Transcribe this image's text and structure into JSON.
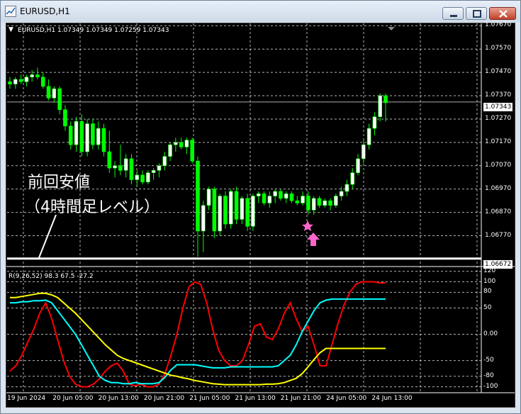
{
  "window": {
    "title": "EURUSD,H1",
    "buttons": {
      "minimize": "minimize",
      "maximize": "maximize",
      "close": "close"
    }
  },
  "chart_header": "EURUSD,H1  1.07349 1.07349 1.07259 1.07343",
  "price_axis": [
    "1.07670",
    "1.07570",
    "1.07470",
    "1.07370",
    "1.07270",
    "1.07170",
    "1.07070",
    "1.06970",
    "1.06870",
    "1.06770"
  ],
  "current_price_label": "1.07343",
  "support_price_label": "1.06672",
  "annotation": {
    "line1": "前回安値",
    "line2": "（4時間足レベル）"
  },
  "indicator_header": "R(9,26,52) 98.3 67.5 -27.2",
  "indicator_axis": [
    "120",
    "100",
    "80",
    "50",
    "0.00",
    "-50",
    "-80",
    "-100"
  ],
  "time_axis": [
    "19 Jun 2024",
    "20 Jun 05:00",
    "20 Jun 13:00",
    "20 Jun 21:00",
    "21 Jun 05:00",
    "21 Jun 13:00",
    "21 Jun 21:00",
    "24 Jun 05:00",
    "24 Jun 13:00"
  ],
  "colors": {
    "background": "#000000",
    "grid": "#ffffff",
    "bull_candle": "#ffffff",
    "bear_candle": "#00ff00",
    "indicator_fast": "#ff0000",
    "indicator_mid": "#00ffff",
    "indicator_slow": "#ffff00",
    "marker": "#ff66cc"
  },
  "chart_data": [
    {
      "type": "candlestick",
      "title": "EURUSD,H1",
      "ylim": [
        1.0665,
        1.0768
      ],
      "current_price": 1.07343,
      "support_level": 1.06672,
      "candles": [
        [
          1.0743,
          1.0745,
          1.074,
          1.0742
        ],
        [
          1.0742,
          1.0745,
          1.074,
          1.0744
        ],
        [
          1.0744,
          1.0746,
          1.0742,
          1.0743
        ],
        [
          1.0743,
          1.0746,
          1.0741,
          1.0745
        ],
        [
          1.0745,
          1.0748,
          1.0743,
          1.0746
        ],
        [
          1.0746,
          1.0749,
          1.0744,
          1.0745
        ],
        [
          1.0745,
          1.0747,
          1.074,
          1.0741
        ],
        [
          1.0741,
          1.0744,
          1.0735,
          1.0736
        ],
        [
          1.0736,
          1.0741,
          1.0734,
          1.074
        ],
        [
          1.074,
          1.0741,
          1.0729,
          1.0731
        ],
        [
          1.0731,
          1.0733,
          1.0722,
          1.0724
        ],
        [
          1.0724,
          1.0726,
          1.0714,
          1.0716
        ],
        [
          1.0716,
          1.0728,
          1.0713,
          1.0726
        ],
        [
          1.0726,
          1.0729,
          1.0711,
          1.0713
        ],
        [
          1.0713,
          1.0727,
          1.0711,
          1.0725
        ],
        [
          1.0725,
          1.0727,
          1.0714,
          1.0716
        ],
        [
          1.0716,
          1.0726,
          1.0714,
          1.0723
        ],
        [
          1.0723,
          1.0725,
          1.0711,
          1.0713
        ],
        [
          1.0713,
          1.0722,
          1.0704,
          1.0706
        ],
        [
          1.0706,
          1.0709,
          1.0702,
          1.0707
        ],
        [
          1.0707,
          1.0716,
          1.0703,
          1.0705
        ],
        [
          1.0705,
          1.0712,
          1.0702,
          1.071
        ],
        [
          1.071,
          1.0712,
          1.0699,
          1.0701
        ],
        [
          1.0701,
          1.0705,
          1.0698,
          1.0703
        ],
        [
          1.0703,
          1.0705,
          1.0699,
          1.07
        ],
        [
          1.07,
          1.0705,
          1.0699,
          1.0704
        ],
        [
          1.0704,
          1.0706,
          1.0701,
          1.0705
        ],
        [
          1.0705,
          1.0708,
          1.0702,
          1.0707
        ],
        [
          1.0707,
          1.0713,
          1.0705,
          1.0711
        ],
        [
          1.0711,
          1.0717,
          1.0709,
          1.0716
        ],
        [
          1.0716,
          1.0719,
          1.0713,
          1.0717
        ],
        [
          1.0717,
          1.0719,
          1.0714,
          1.0715
        ],
        [
          1.0715,
          1.0719,
          1.0712,
          1.0718
        ],
        [
          1.0718,
          1.0719,
          1.0708,
          1.0709
        ],
        [
          1.0709,
          1.0711,
          1.0668,
          1.0679
        ],
        [
          1.0679,
          1.0692,
          1.067,
          1.069
        ],
        [
          1.069,
          1.0698,
          1.0688,
          1.0697
        ],
        [
          1.0697,
          1.0698,
          1.0676,
          1.0679
        ],
        [
          1.0679,
          1.0695,
          1.0677,
          1.0694
        ],
        [
          1.0694,
          1.0696,
          1.068,
          1.0682
        ],
        [
          1.0682,
          1.0697,
          1.068,
          1.0696
        ],
        [
          1.0696,
          1.0698,
          1.0682,
          1.0684
        ],
        [
          1.0684,
          1.0694,
          1.0682,
          1.0693
        ],
        [
          1.0693,
          1.0695,
          1.0679,
          1.0681
        ],
        [
          1.0681,
          1.0695,
          1.0679,
          1.0694
        ],
        [
          1.0694,
          1.0696,
          1.0691,
          1.0695
        ],
        [
          1.0695,
          1.0696,
          1.069,
          1.0691
        ],
        [
          1.0691,
          1.0696,
          1.0689,
          1.0694
        ],
        [
          1.0694,
          1.0697,
          1.0691,
          1.0696
        ],
        [
          1.0696,
          1.0697,
          1.0692,
          1.0693
        ],
        [
          1.0693,
          1.0696,
          1.0691,
          1.0695
        ],
        [
          1.0695,
          1.0696,
          1.0691,
          1.0692
        ],
        [
          1.0692,
          1.0694,
          1.069,
          1.0691
        ],
        [
          1.0691,
          1.0696,
          1.069,
          1.0694
        ],
        [
          1.0694,
          1.0696,
          1.0686,
          1.0688
        ],
        [
          1.0688,
          1.0694,
          1.0686,
          1.0693
        ],
        [
          1.0693,
          1.0694,
          1.0689,
          1.069
        ],
        [
          1.069,
          1.0693,
          1.0689,
          1.0692
        ],
        [
          1.0692,
          1.0693,
          1.0688,
          1.069
        ],
        [
          1.069,
          1.0695,
          1.0689,
          1.0694
        ],
        [
          1.0694,
          1.0698,
          1.0692,
          1.0696
        ],
        [
          1.0696,
          1.0701,
          1.0694,
          1.0699
        ],
        [
          1.0699,
          1.0706,
          1.0697,
          1.0704
        ],
        [
          1.0704,
          1.0712,
          1.0703,
          1.071
        ],
        [
          1.071,
          1.0718,
          1.0708,
          1.0716
        ],
        [
          1.0716,
          1.0725,
          1.0714,
          1.0723
        ],
        [
          1.0723,
          1.073,
          1.072,
          1.0728
        ],
        [
          1.0728,
          1.0738,
          1.0726,
          1.0737
        ],
        [
          1.0737,
          1.0738,
          1.0726,
          1.0734
        ]
      ]
    },
    {
      "type": "line",
      "title": "R(9,26,52) 98.3 67.5 -27.2",
      "ylim": [
        -110,
        125
      ],
      "series": [
        {
          "name": "R(9)",
          "values": [
            -70,
            -60,
            -40,
            -15,
            10,
            40,
            60,
            30,
            -10,
            -50,
            -80,
            -95,
            -100,
            -100,
            -95,
            -85,
            -70,
            -60,
            -55,
            -70,
            -95,
            -98,
            -95,
            -100,
            -100,
            -95,
            -75,
            -40,
            0,
            50,
            90,
            100,
            95,
            60,
            10,
            -30,
            -50,
            -60,
            -60,
            -50,
            -20,
            15,
            20,
            -5,
            -10,
            10,
            40,
            60,
            30,
            5,
            15,
            -20,
            -60,
            -60,
            -20,
            20,
            55,
            80,
            95,
            100,
            100,
            100,
            98,
            98
          ]
        },
        {
          "name": "R(26)",
          "values": [
            60,
            60,
            62,
            62,
            64,
            64,
            65,
            60,
            45,
            30,
            15,
            0,
            -20,
            -40,
            -60,
            -80,
            -88,
            -92,
            -92,
            -94,
            -94,
            -92,
            -94,
            -94,
            -94,
            -92,
            -82,
            -68,
            -58,
            -58,
            -58,
            -58,
            -60,
            -62,
            -64,
            -64,
            -64,
            -62,
            -62,
            -62,
            -62,
            -62,
            -62,
            -62,
            -62,
            -60,
            -50,
            -40,
            -20,
            5,
            25,
            45,
            60,
            65,
            67,
            67,
            67,
            67,
            67,
            67,
            67,
            67,
            67,
            67
          ]
        },
        {
          "name": "R(52)",
          "values": [
            70,
            70,
            72,
            74,
            76,
            78,
            78,
            75,
            70,
            60,
            50,
            40,
            28,
            16,
            4,
            -8,
            -20,
            -30,
            -40,
            -46,
            -50,
            -54,
            -58,
            -62,
            -66,
            -70,
            -74,
            -78,
            -80,
            -83,
            -85,
            -88,
            -90,
            -92,
            -94,
            -95,
            -96,
            -96,
            -96,
            -96,
            -96,
            -96,
            -96,
            -95,
            -95,
            -94,
            -92,
            -88,
            -84,
            -75,
            -62,
            -48,
            -35,
            -27,
            -27,
            -27,
            -27,
            -27,
            -27,
            -27,
            -27,
            -27,
            -27,
            -27
          ]
        }
      ]
    }
  ]
}
